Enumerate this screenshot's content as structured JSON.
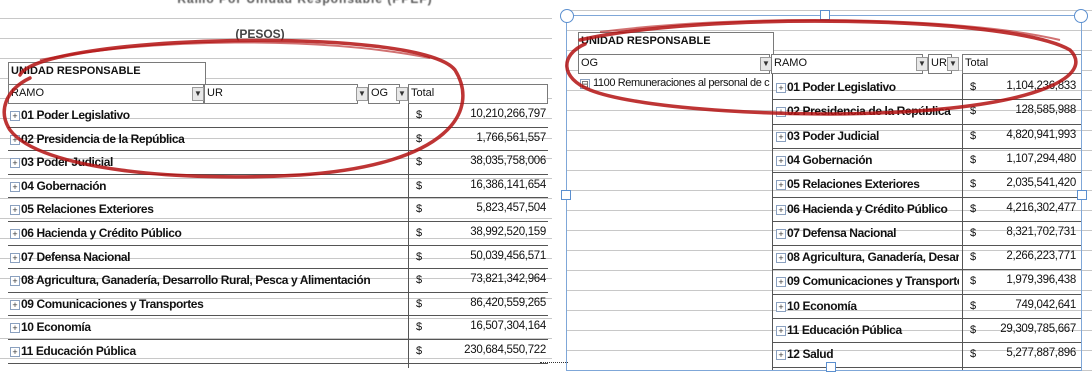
{
  "left": {
    "cutoff_title": "Ramo Por Unidad Responsable (PPEF)",
    "pesos_label": "(PESOS)",
    "unidad_label": "UNIDAD RESPONSABLE",
    "ramo_label": "RAMO",
    "ur_label": "UR",
    "og_label": "OG",
    "total_label": "Total",
    "currency": "$",
    "rows": [
      {
        "label": "01 Poder Legislativo",
        "value": "10,210,266,797"
      },
      {
        "label": "02 Presidencia de la República",
        "value": "1,766,561,557"
      },
      {
        "label": "03 Poder Judicial",
        "value": "38,035,758,006"
      },
      {
        "label": "04 Gobernación",
        "value": "16,386,141,654"
      },
      {
        "label": "05 Relaciones Exteriores",
        "value": "5,823,457,504"
      },
      {
        "label": "06 Hacienda y Crédito Público",
        "value": "38,992,520,159"
      },
      {
        "label": "07 Defensa Nacional",
        "value": "50,039,456,571"
      },
      {
        "label": "08 Agricultura, Ganadería, Desarrollo Rural, Pesca y Alimentación",
        "value": "73,821,342,964"
      },
      {
        "label": "09 Comunicaciones y Transportes",
        "value": "86,420,559,265"
      },
      {
        "label": "10 Economía",
        "value": "16,507,304,164"
      },
      {
        "label": "11 Educación Pública",
        "value": "230,684,550,722"
      }
    ]
  },
  "right": {
    "unidad_label": "UNIDAD RESPONSABLE",
    "og_label": "OG",
    "ramo_label": "RAMO",
    "ur_label": "UR",
    "total_label": "Total",
    "og_item": "1100 Remuneraciones al personal de c",
    "currency": "$",
    "rows": [
      {
        "label": "01 Poder Legislativo",
        "value": "1,104,236,833"
      },
      {
        "label": "02 Presidencia de la República",
        "value": "128,585,988"
      },
      {
        "label": "03 Poder Judicial",
        "value": "4,820,941,993"
      },
      {
        "label": "04 Gobernación",
        "value": "1,107,294,480"
      },
      {
        "label": "05 Relaciones Exteriores",
        "value": "2,035,541,420"
      },
      {
        "label": "06 Hacienda y Crédito Público",
        "value": "4,216,302,477"
      },
      {
        "label": "07 Defensa Nacional",
        "value": "8,321,702,731"
      },
      {
        "label": "08 Agricultura, Ganadería, Desar",
        "value": "2,266,223,771"
      },
      {
        "label": "09 Comunicaciones y Transportes",
        "value": "1,979,396,438"
      },
      {
        "label": "10 Economía",
        "value": "749,042,641"
      },
      {
        "label": "11 Educación Pública",
        "value": "29,309,785,667"
      },
      {
        "label": "12 Salud",
        "value": "5,277,887,896"
      }
    ]
  },
  "colors": {
    "annotation_red": "#b31212",
    "selection_blue": "#5b8fcf",
    "grid_gray": "#c8c8c8"
  },
  "icons": {
    "expand": "plus-box-icon",
    "dropdown": "dropdown-arrow-icon",
    "resize": "resize-handle-icon"
  }
}
